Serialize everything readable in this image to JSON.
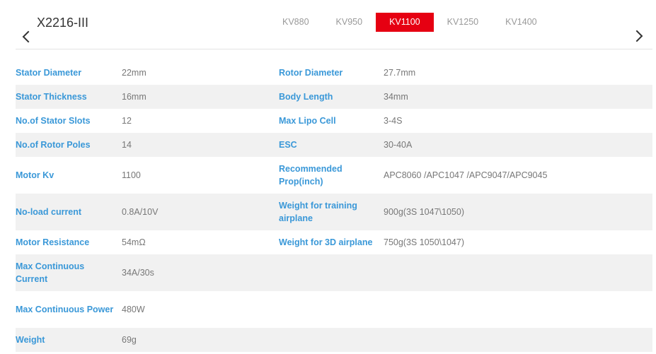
{
  "title": "X2216-III",
  "tabs": [
    {
      "label": "KV880",
      "active": false
    },
    {
      "label": "KV950",
      "active": false
    },
    {
      "label": "KV1100",
      "active": true
    },
    {
      "label": "KV1250",
      "active": false
    },
    {
      "label": "KV1400",
      "active": false
    }
  ],
  "icons": {
    "prev": "chevron-left-icon",
    "next": "chevron-right-icon"
  },
  "colors": {
    "accent": "#e60012",
    "label": "#3a98d8",
    "value": "#777777",
    "stripe": "#f1f1f1"
  },
  "specs": [
    {
      "l1": "Stator Diameter",
      "v1": "22mm",
      "l2": "Rotor Diameter",
      "v2": "27.7mm"
    },
    {
      "l1": "Stator Thickness",
      "v1": "16mm",
      "l2": "Body Length",
      "v2": "34mm"
    },
    {
      "l1": "No.of Stator Slots",
      "v1": "12",
      "l2": "Max Lipo Cell",
      "v2": "3-4S"
    },
    {
      "l1": "No.of Rotor Poles",
      "v1": "14",
      "l2": "ESC",
      "v2": "30-40A"
    },
    {
      "l1": "Motor Kv",
      "v1": "1100",
      "l2": "Recommended Prop(inch)",
      "v2": "APC8060 /APC1047 /APC9047/APC9045"
    },
    {
      "l1": "No-load current",
      "v1": "0.8A/10V",
      "l2": "Weight for training airplane",
      "v2": "900g(3S 1047\\1050)"
    },
    {
      "l1": "Motor Resistance",
      "v1": "54mΩ",
      "l2": "Weight for 3D airplane",
      "v2": "750g(3S 1050\\1047)"
    },
    {
      "l1": "Max Continuous Current",
      "v1": "34A/30s",
      "l2": "",
      "v2": ""
    },
    {
      "l1": "Max Continuous Power",
      "v1": "480W",
      "l2": "",
      "v2": ""
    },
    {
      "l1": "Weight",
      "v1": "69g",
      "l2": "",
      "v2": ""
    }
  ]
}
